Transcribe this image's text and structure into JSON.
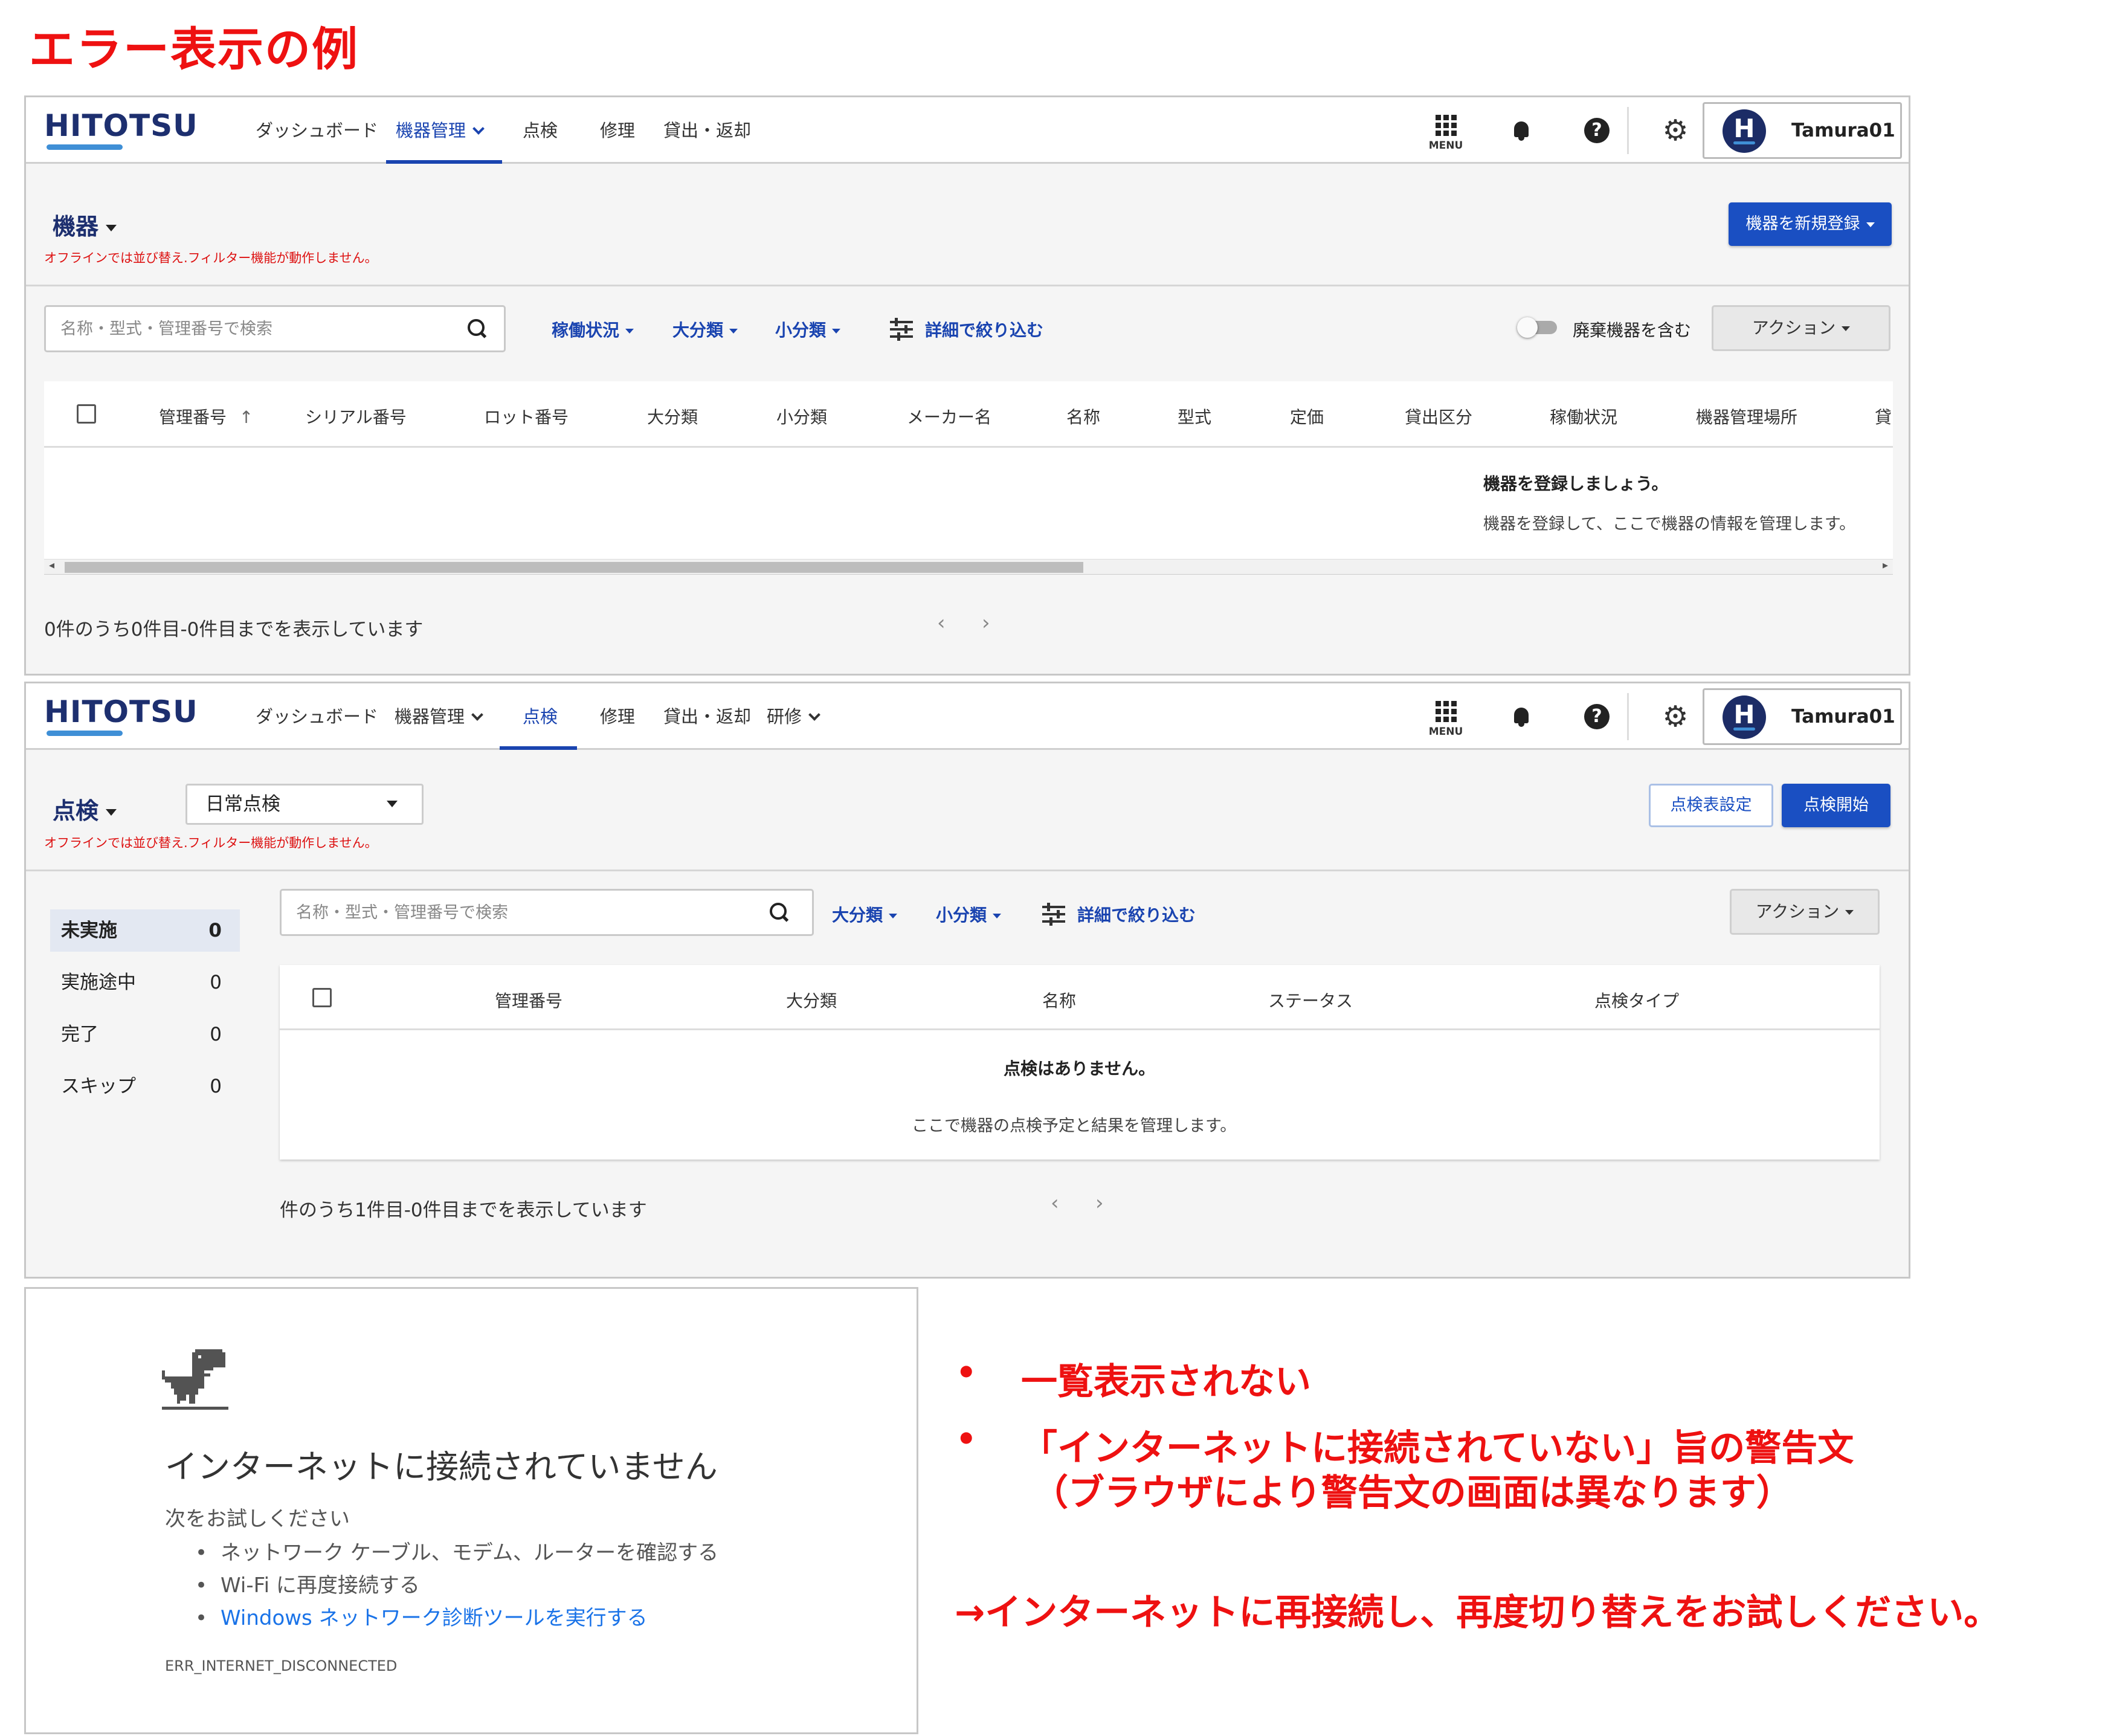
{
  "heading": "エラー表示の例",
  "app": {
    "logo": "HITOTSU",
    "user_initial": "H",
    "user_name": "Tamura01",
    "menu_label": "MENU",
    "accent_color": "#1a4fc2",
    "error_color": "#ee1111",
    "icons": [
      "menu-grid-icon",
      "bell-icon",
      "help-icon",
      "gear-icon",
      "search-icon",
      "tune-icon"
    ]
  },
  "screen1": {
    "nav": [
      "ダッシュボード",
      "機器管理",
      "点検",
      "修理",
      "貸出・返却"
    ],
    "active_nav": "機器管理",
    "section_title": "機器",
    "offline_notice": "オフラインでは並び替え.フィルター機能が動作しません。",
    "primary_button": "機器を新規登録",
    "search_placeholder": "名称・型式・管理番号で検索",
    "filters": [
      "稼働状況",
      "大分類",
      "小分類"
    ],
    "detail_filter": "詳細で絞り込む",
    "toggle_label": "廃棄機器を含む",
    "action_button": "アクション",
    "columns": [
      "管理番号",
      "シリアル番号",
      "ロット番号",
      "大分類",
      "小分類",
      "メーカー名",
      "名称",
      "型式",
      "定価",
      "貸出区分",
      "稼働状況",
      "機器管理場所",
      "貸"
    ],
    "sort_indicator": "↑",
    "empty_title": "機器を登録しましょう。",
    "empty_message": "機器を登録して、ここで機器の情報を管理します。",
    "pagination_text": "0件のうち0件目-0件目までを表示しています",
    "prev": "‹",
    "next": "›"
  },
  "screen2": {
    "nav": [
      "ダッシュボード",
      "機器管理",
      "点検",
      "修理",
      "貸出・返却",
      "研修"
    ],
    "active_nav": "点検",
    "section_title": "点検",
    "inspection_type": "日常点検",
    "offline_notice": "オフラインでは並び替え.フィルター機能が動作しません。",
    "settings_button": "点検表設定",
    "start_button": "点検開始",
    "search_placeholder": "名称・型式・管理番号で検索",
    "filters": [
      "大分類",
      "小分類"
    ],
    "detail_filter": "詳細で絞り込む",
    "action_button": "アクション",
    "status_list": [
      {
        "label": "未実施",
        "count": "0"
      },
      {
        "label": "実施途中",
        "count": "0"
      },
      {
        "label": "完了",
        "count": "0"
      },
      {
        "label": "スキップ",
        "count": "0"
      }
    ],
    "columns": [
      "管理番号",
      "大分類",
      "名称",
      "ステータス",
      "点検タイプ"
    ],
    "empty_title": "点検はありません。",
    "empty_message": "ここで機器の点検予定と結果を管理します。",
    "pagination_text": "件のうち1件目-0件目までを表示しています",
    "prev": "‹",
    "next": "›"
  },
  "browser_error": {
    "title": "インターネットに接続されていません",
    "try_text": "次をお試しください",
    "suggestions": [
      "ネットワーク ケーブル、モデム、ルーターを確認する",
      "Wi-Fi に再度接続する",
      "Windows ネットワーク診断ツールを実行する"
    ],
    "error_code": "ERR_INTERNET_DISCONNECTED"
  },
  "notes": {
    "bullet": "•",
    "point1": "一覧表示されない",
    "point2_line1": "「インターネットに接続されていない」旨の警告文",
    "point2_line2": "（ブラウザにより警告文の画面は異なります）",
    "conclusion": "→インターネットに再接続し、再度切り替えをお試しください。"
  }
}
